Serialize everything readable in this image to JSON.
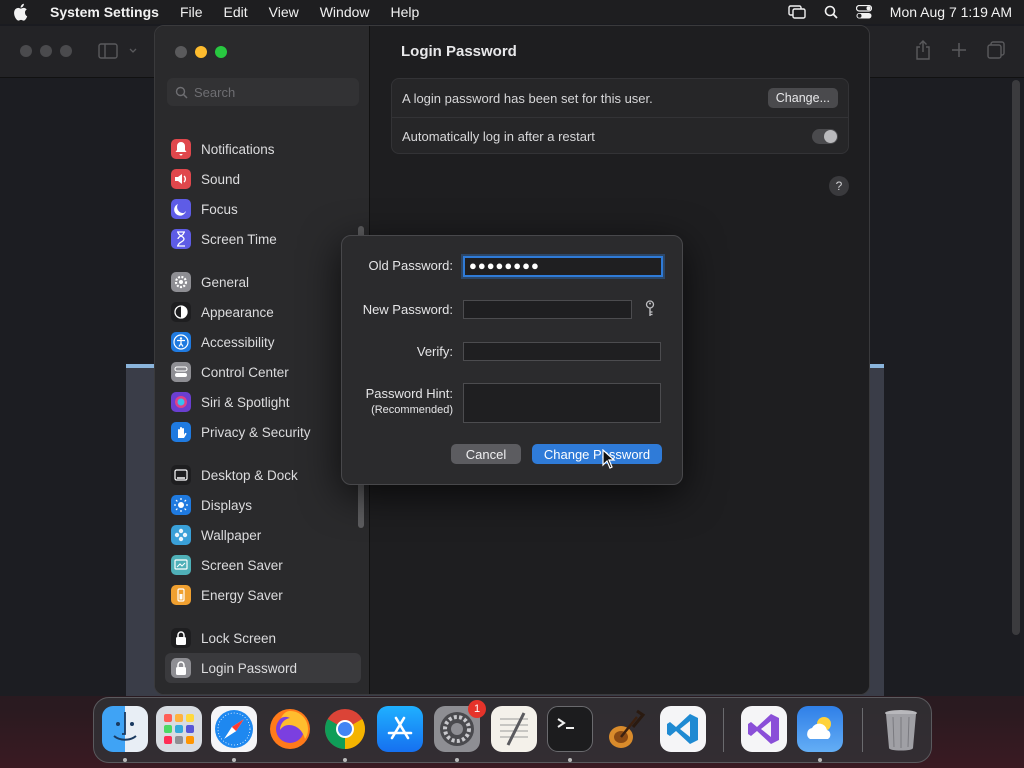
{
  "menubar": {
    "app_name": "System Settings",
    "menus": [
      "File",
      "Edit",
      "View",
      "Window",
      "Help"
    ],
    "clock": "Mon Aug 7  1:19 AM"
  },
  "sidebar": {
    "search_placeholder": "Search",
    "groups": [
      [
        {
          "label": "Notifications",
          "icon": "bell-icon",
          "color": "#e0474c"
        },
        {
          "label": "Sound",
          "icon": "speaker-icon",
          "color": "#e0474c"
        },
        {
          "label": "Focus",
          "icon": "moon-icon",
          "color": "#5e5ce6"
        },
        {
          "label": "Screen Time",
          "icon": "hourglass-icon",
          "color": "#5e5ce6"
        }
      ],
      [
        {
          "label": "General",
          "icon": "gear-icon",
          "color": "#8e8e93"
        },
        {
          "label": "Appearance",
          "icon": "appearance-icon",
          "color": "#3a3a3c"
        },
        {
          "label": "Accessibility",
          "icon": "accessibility-icon",
          "color": "#1f7ae0"
        },
        {
          "label": "Control Center",
          "icon": "control-center-icon",
          "color": "#8e8e93"
        },
        {
          "label": "Siri & Spotlight",
          "icon": "siri-icon",
          "color": "#6a3fd0"
        },
        {
          "label": "Privacy & Security",
          "icon": "hand-icon",
          "color": "#1f7ae0"
        }
      ],
      [
        {
          "label": "Desktop & Dock",
          "icon": "dock-icon",
          "color": "#3a3a3c"
        },
        {
          "label": "Displays",
          "icon": "sun-icon",
          "color": "#1f7ae0"
        },
        {
          "label": "Wallpaper",
          "icon": "flower-icon",
          "color": "#3aa0d8"
        },
        {
          "label": "Screen Saver",
          "icon": "screensaver-icon",
          "color": "#4fb0b8"
        },
        {
          "label": "Energy Saver",
          "icon": "battery-icon",
          "color": "#f0a030"
        }
      ],
      [
        {
          "label": "Lock Screen",
          "icon": "lock-icon",
          "color": "#3a3a3c"
        },
        {
          "label": "Login Password",
          "icon": "login-password-icon",
          "color": "#8e8e93",
          "active": true
        }
      ]
    ]
  },
  "content": {
    "title": "Login Password",
    "password_set_text": "A login password has been set for this user.",
    "change_button": "Change...",
    "auto_login_text": "Automatically log in after a restart",
    "help": "?"
  },
  "dialog": {
    "old_password_label": "Old Password:",
    "old_password_value": "●●●●●●●●",
    "new_password_label": "New Password:",
    "verify_label": "Verify:",
    "hint_label": "Password Hint:",
    "hint_sublabel": "(Recommended)",
    "cancel_label": "Cancel",
    "submit_label": "Change Password"
  },
  "dock": {
    "badge_count": "1",
    "apps": [
      "finder",
      "launchpad",
      "safari",
      "firefox",
      "chrome",
      "app-store",
      "system-settings",
      "textedit",
      "terminal",
      "garageband",
      "vscode",
      "visual-studio",
      "weather",
      "trash"
    ]
  }
}
